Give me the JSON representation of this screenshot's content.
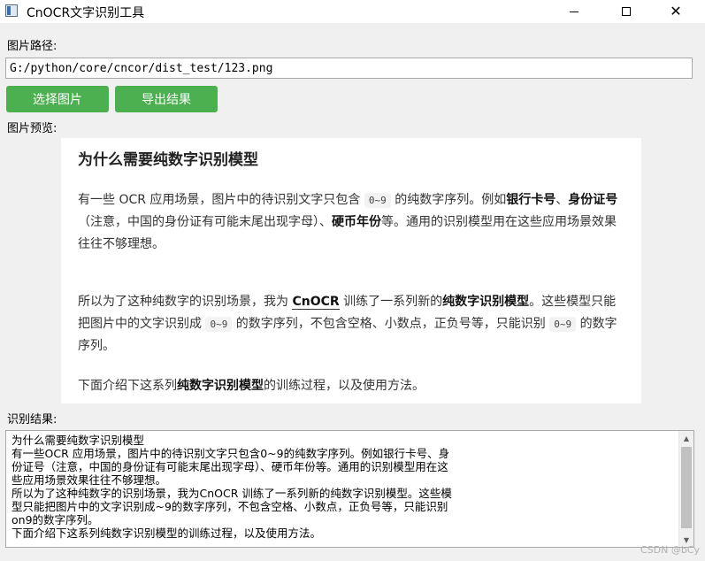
{
  "window": {
    "title": "CnOCR文字识别工具",
    "close_glyph": "✕"
  },
  "image_path": {
    "label": "图片路径:",
    "value": "G:/python/core/cncor/dist_test/123.png"
  },
  "buttons": {
    "select_image": "选择图片",
    "export_result": "导出结果"
  },
  "preview": {
    "label": "图片预览:",
    "heading": "为什么需要纯数字识别模型",
    "p1": {
      "t1": "有一些 OCR 应用场景，图片中的待识别文字只包含",
      "code": "0~9",
      "t2": "的纯数字序列。例如",
      "b1": "银行卡号",
      "t3": "、",
      "b2": "身份证号",
      "t4": "（注意，中国的身份证有可能末尾出现字母）、",
      "b3": "硬币年份",
      "t5": "等。通用的识别模型用在这些应用场景效果往往不够理想。"
    },
    "p2": {
      "t1": "所以为了这种纯数字的识别场景，我为",
      "link": "CnOCR",
      "t2": "训练了一系列新的",
      "b1": "纯数字识别模型",
      "t3": "。这些模型只能把图片中的文字识别成",
      "code1": "0~9",
      "t4": "的数字序列，不包含空格、小数点，正负号等，只能识别",
      "code2": "0~9",
      "t5": "的数字序列。"
    },
    "p3": {
      "t1": "下面介绍下这系列",
      "b1": "纯数字识别模型",
      "t2": "的训练过程，以及使用方法。"
    }
  },
  "result": {
    "label": "识别结果:",
    "text": "为什么需要纯数字识别模型\n有一些OCR 应用场景，图片中的待识别文字只包含0~9的纯数字序列。例如银行卡号、身\n份证号（注意，中国的身份证有可能末尾出现字母）、硬币年份等。通用的识别模型用在这\n些应用场景效果往往不够理想。\n所以为了这种纯数字的识别场景，我为CnOCR 训练了一系列新的纯数字识别模型。这些模\n型只能把图片中的文字识别成~9的数字序列，不包含空格、小数点，正负号等，只能识别\non9的数字序列。\n下面介绍下这系列纯数字识别模型的训练过程，以及使用方法。"
  },
  "watermark": "CSDN @bCy"
}
